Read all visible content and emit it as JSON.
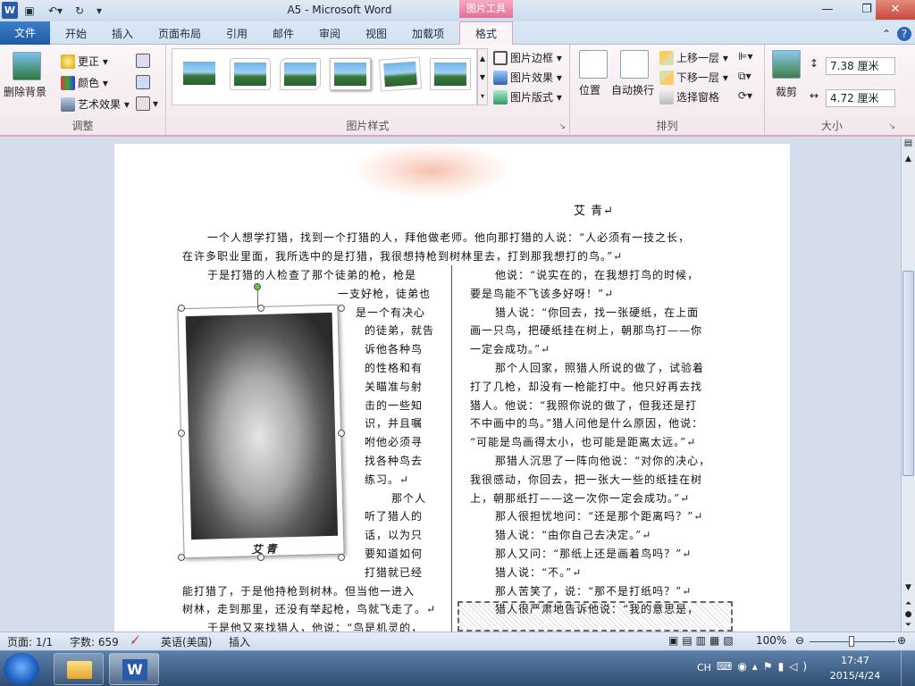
{
  "window": {
    "title": "A5 - Microsoft Word",
    "contextual_tab_group": "图片工具"
  },
  "tabs": [
    "文件",
    "开始",
    "插入",
    "页面布局",
    "引用",
    "邮件",
    "审阅",
    "视图",
    "加载项",
    "格式"
  ],
  "ribbon": {
    "adjust": {
      "label": "调整",
      "remove_bg": "删除背景",
      "corrections": "更正",
      "color": "颜色",
      "artistic": "艺术效果"
    },
    "picture_styles": {
      "label": "图片样式",
      "border": "图片边框",
      "effects": "图片效果",
      "layout": "图片版式"
    },
    "arrange": {
      "label": "排列",
      "position": "位置",
      "wrap": "自动换行",
      "bring_forward": "上移一层",
      "send_backward": "下移一层",
      "selection_pane": "选择窗格"
    },
    "size": {
      "label": "大小",
      "crop": "裁剪",
      "height": "7.38 厘米",
      "width": "4.72 厘米"
    }
  },
  "document": {
    "author": "艾 青↵",
    "intro_1": "一个人想学打猎，找到一个打猎的人，拜他做老师。他向那打猎的人说：“人必须有一技之长，",
    "intro_2": "在许多职业里面，我所选中的是打猎，我很想持枪到树林里去，打到那我想打的鸟。”↵",
    "left": [
      "于是打猎的人检查了那个徒弟的枪，枪是",
      "一支好枪，徒弟也",
      "是一个有决心",
      "的徒弟，就告",
      "诉他各种鸟",
      "的性格和有",
      "关瞄准与射",
      "击的一些知",
      "识，并且嘱",
      "咐他必须寻",
      "找各种鸟去",
      "练习。↵",
      "那个人",
      "听了猎人的",
      "话，以为只",
      "要知道如何",
      "打猎就已经",
      "能打猎了，于是他持枪到树林。但当他一进入",
      "树林，走到那里，还没有举起枪，鸟就飞走了。↵",
      "于是他又来找猎人，他说：“鸟是机灵的，"
    ],
    "right": [
      "他说：“说实在的，在我想打鸟的时候，",
      "要是鸟能不飞该多好呀！”↵",
      "猎人说：“你回去，找一张硬纸，在上面",
      "画一只鸟，把硬纸挂在树上，朝那鸟打——你",
      "一定会成功。”↵",
      "那个人回家，照猎人所说的做了，试验着",
      "打了几枪，却没有一枪能打中。他只好再去找",
      "猎人。他说：“我照你说的做了，但我还是打",
      "不中画中的鸟。”猎人问他是什么原因，他说：",
      "“可能是鸟画得太小，也可能是距离太远。”↵",
      "那猎人沉思了一阵向他说：“对你的决心，",
      "我很感动，你回去，把一张大一些的纸挂在树",
      "上，朝那纸打——这一次你一定会成功。”↵",
      "那人很担忧地问：“还是那个距离吗？”↵",
      "猎人说：“由你自己去决定。”↵",
      "那人又问：“那纸上还是画着鸟吗？”↵",
      "猎人说：“不。”↵",
      "那人苦笑了，说：“那不是打纸吗？”↵",
      "猎人很严肃地告诉他说：“我的意思是，"
    ],
    "caption": "艾 青"
  },
  "status_bar": {
    "page": "页面: 1/1",
    "words": "字数: 659",
    "language": "英语(美国)",
    "mode": "插入",
    "zoom": "100%"
  },
  "taskbar": {
    "ime": "CH",
    "time": "17:47",
    "date": "2015/4/24"
  }
}
